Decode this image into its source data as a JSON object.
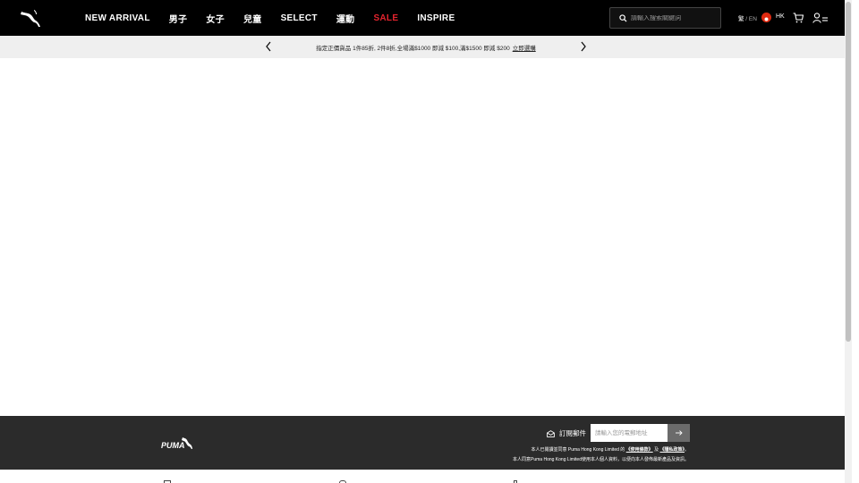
{
  "header": {
    "nav": [
      {
        "label": "NEW ARRIVAL"
      },
      {
        "label": "男子"
      },
      {
        "label": "女子"
      },
      {
        "label": "兒童"
      },
      {
        "label": "SELECT"
      },
      {
        "label": "運動"
      },
      {
        "label": "SALE"
      },
      {
        "label": "INSPIRE"
      }
    ],
    "search_placeholder": "請輸入搜索關鍵詞",
    "lang_zh": "繁",
    "lang_sep": " / ",
    "lang_en": "EN",
    "region": "HK",
    "icons": [
      "puma-logo-icon",
      "search-icon",
      "hk-flag-icon",
      "cart-icon",
      "account-menu-icon"
    ]
  },
  "promo": {
    "text": "指定正價貨品 1件85折, 2件8折,全場滿$1000 即減 $100,滿$1500 即減 $200",
    "link": "立即選購"
  },
  "footer": {
    "subscribe_label": "訂閱郵件",
    "email_placeholder": "請輸入您的電郵地址",
    "legal_line1_prefix": "本人已閱讀並同意 Puma Hong Kong Limited 的 ",
    "terms_link": "《使用條款》",
    "and": " 及 ",
    "privacy_link": "《隱私政策》",
    "legal_line1_suffix": "。",
    "legal_line2": "本人同意Puma Hong Kong Limited使用本人個人資料，以便向本人發佈最新產品及資訊。"
  },
  "colors": {
    "header_bg": "#000000",
    "sale": "#e4242e",
    "promo_bg": "#efefef",
    "footer_bg": "#2b2b2b"
  }
}
